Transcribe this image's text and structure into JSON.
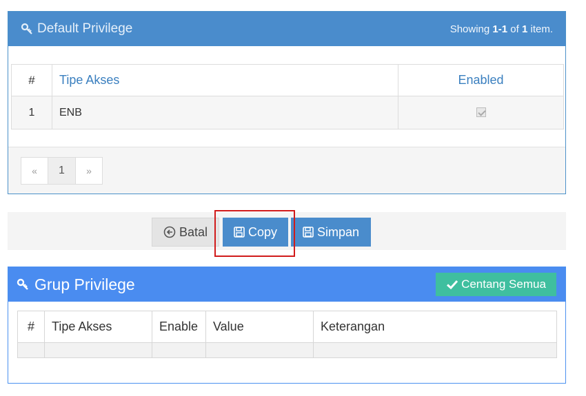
{
  "default_privilege": {
    "title": "Default Privilege",
    "summary": {
      "prefix": "Showing ",
      "range": "1-1",
      "of": " of ",
      "total": "1",
      "suffix": " item."
    },
    "columns": {
      "num": "#",
      "tipe_akses": "Tipe Akses",
      "enabled": "Enabled"
    },
    "rows": [
      {
        "num": "1",
        "tipe_akses": "ENB",
        "enabled": true
      }
    ],
    "pager": {
      "prev": "«",
      "current": "1",
      "next": "»"
    }
  },
  "actions": {
    "batal": "Batal",
    "copy": "Copy",
    "simpan": "Simpan"
  },
  "grup_privilege": {
    "title": "Grup Privilege",
    "check_all": "Centang Semua",
    "columns": {
      "num": "#",
      "tipe_akses": "Tipe Akses",
      "enable": "Enable",
      "value": "Value",
      "keterangan": "Keterangan"
    }
  },
  "icons": {
    "key": "key-icon",
    "back": "circle-arrow-left-icon",
    "save": "floppy-disk-icon",
    "check": "check-icon"
  },
  "colors": {
    "panel1_header": "#4a8ccc",
    "panel2_header": "#4a8cf0",
    "primary_button": "#4a8ccc",
    "success_button": "#3fbf9f",
    "highlight": "#d11a1a"
  }
}
